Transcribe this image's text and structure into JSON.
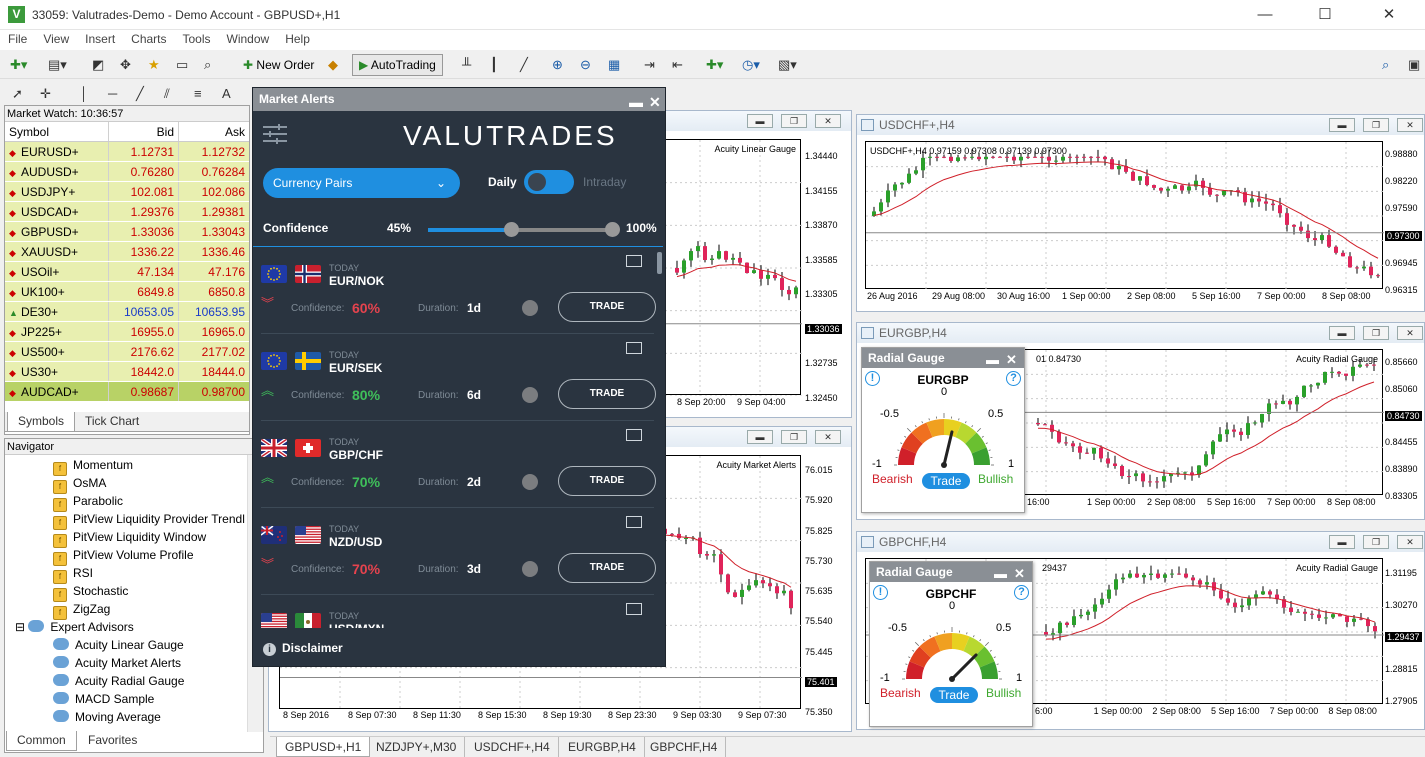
{
  "window": {
    "title": "33059: Valutrades-Demo - Demo Account - GBPUSD+,H1",
    "icon_letter": "V",
    "minimize": "—",
    "maximize": "☐",
    "close": "✕"
  },
  "menu": [
    "File",
    "View",
    "Insert",
    "Charts",
    "Tools",
    "Window",
    "Help"
  ],
  "toolbar": {
    "new_order_label": "New Order",
    "autotrading_label": "AutoTrading"
  },
  "market_watch": {
    "title": "Market Watch: 10:36:57",
    "columns": [
      "Symbol",
      "Bid",
      "Ask"
    ],
    "rows": [
      {
        "symbol": "EURUSD+",
        "bid": "1.12731",
        "ask": "1.12732",
        "dir": "down",
        "color": "red"
      },
      {
        "symbol": "AUDUSD+",
        "bid": "0.76280",
        "ask": "0.76284",
        "dir": "down",
        "color": "red"
      },
      {
        "symbol": "USDJPY+",
        "bid": "102.081",
        "ask": "102.086",
        "dir": "down",
        "color": "red"
      },
      {
        "symbol": "USDCAD+",
        "bid": "1.29376",
        "ask": "1.29381",
        "dir": "down",
        "color": "red"
      },
      {
        "symbol": "GBPUSD+",
        "bid": "1.33036",
        "ask": "1.33043",
        "dir": "down",
        "color": "red"
      },
      {
        "symbol": "XAUUSD+",
        "bid": "1336.22",
        "ask": "1336.46",
        "dir": "down",
        "color": "red"
      },
      {
        "symbol": "USOil+",
        "bid": "47.134",
        "ask": "47.176",
        "dir": "down",
        "color": "red"
      },
      {
        "symbol": "UK100+",
        "bid": "6849.8",
        "ask": "6850.8",
        "dir": "down",
        "color": "red"
      },
      {
        "symbol": "DE30+",
        "bid": "10653.05",
        "ask": "10653.95",
        "dir": "up",
        "color": "blue"
      },
      {
        "symbol": "JP225+",
        "bid": "16955.0",
        "ask": "16965.0",
        "dir": "down",
        "color": "red"
      },
      {
        "symbol": "US500+",
        "bid": "2176.62",
        "ask": "2177.02",
        "dir": "down",
        "color": "red"
      },
      {
        "symbol": "US30+",
        "bid": "18442.0",
        "ask": "18444.0",
        "dir": "down",
        "color": "red"
      },
      {
        "symbol": "AUDCAD+",
        "bid": "0.98687",
        "ask": "0.98700",
        "dir": "down",
        "color": "red"
      }
    ],
    "tabs": [
      "Symbols",
      "Tick Chart"
    ]
  },
  "navigator": {
    "title": "Navigator",
    "indicators": [
      "Momentum",
      "OsMA",
      "Parabolic",
      "PitView Liquidity Provider Trendl",
      "PitView Liquidity Window",
      "PitView Volume Profile",
      "RSI",
      "Stochastic",
      "ZigZag"
    ],
    "ea_group": "Expert Advisors",
    "experts": [
      "Acuity Linear Gauge",
      "Acuity Market Alerts",
      "Acuity Radial Gauge",
      "MACD Sample",
      "Moving Average"
    ],
    "tabs": [
      "Common",
      "Favorites"
    ]
  },
  "charts": {
    "gbpusd": {
      "label": "Acuity Linear Gauge",
      "prices": [
        "1.34440",
        "1.34155",
        "1.33870",
        "1.33585",
        "1.33305",
        "1.33036",
        "1.32735",
        "1.32450"
      ],
      "current": "1.33036",
      "xlabels": [
        "8 Sep 20:00",
        "9 Sep 04:00"
      ]
    },
    "nzdjpy": {
      "label": "Acuity Market Alerts",
      "prices": [
        "76.015",
        "75.920",
        "75.825",
        "75.730",
        "75.635",
        "75.540",
        "75.445",
        "75.401",
        "75.350"
      ],
      "current": "75.401",
      "xlabels": [
        "8 Sep 2016",
        "8 Sep 07:30",
        "8 Sep 11:30",
        "8 Sep 15:30",
        "8 Sep 19:30",
        "8 Sep 23:30",
        "9 Sep 03:30",
        "9 Sep 07:30"
      ]
    },
    "usdchf": {
      "title": "USDCHF+,H4",
      "info": "USDCHF+,H4  0.97159 0.97308 0.97139 0.97300",
      "prices": [
        "0.98880",
        "0.98220",
        "0.97590",
        "0.97300",
        "0.96945",
        "0.96315"
      ],
      "current": "0.97300",
      "xlabels": [
        "26 Aug 2016",
        "29 Aug 08:00",
        "30 Aug 16:00",
        "1 Sep 00:00",
        "2 Sep 08:00",
        "5 Sep 16:00",
        "7 Sep 00:00",
        "8 Sep 08:00"
      ]
    },
    "eurgbp": {
      "title": "EURGBP,H4",
      "info": "01 0.84730",
      "label": "Acuity Radial Gauge",
      "prices": [
        "0.85660",
        "0.85060",
        "0.84730",
        "0.84455",
        "0.83890",
        "0.83305"
      ],
      "current": "0.84730",
      "xlabels": [
        "16:00",
        "1 Sep 00:00",
        "2 Sep 08:00",
        "5 Sep 16:00",
        "7 Sep 00:00",
        "8 Sep 08:00"
      ]
    },
    "gbpchf": {
      "title": "GBPCHF,H4",
      "info": "29437",
      "label": "Acuity Radial Gauge",
      "prices": [
        "1.31195",
        "1.30270",
        "1.29437",
        "1.28815",
        "1.27905"
      ],
      "current": "1.29437",
      "xlabels": [
        "6:00",
        "1 Sep 00:00",
        "2 Sep 08:00",
        "5 Sep 16:00",
        "7 Sep 00:00",
        "8 Sep 08:00"
      ]
    }
  },
  "market_alerts": {
    "title": "Market Alerts",
    "logo": "VALUTRADES",
    "filter": "Currency Pairs",
    "period_left": "Daily",
    "period_right": "Intraday",
    "confidence_label": "Confidence",
    "confidence_min": "45%",
    "confidence_max": "100%",
    "confidence_min_frac": 0.45,
    "today": "TODAY",
    "conf_text": "Confidence:",
    "dur_text": "Duration:",
    "trade": "TRADE",
    "disclaimer": "Disclaimer",
    "alerts": [
      {
        "pair": "EUR/NOK",
        "confidence": "60%",
        "duration": "1d",
        "dir": "down"
      },
      {
        "pair": "EUR/SEK",
        "confidence": "80%",
        "duration": "6d",
        "dir": "up"
      },
      {
        "pair": "GBP/CHF",
        "confidence": "70%",
        "duration": "2d",
        "dir": "up"
      },
      {
        "pair": "NZD/USD",
        "confidence": "70%",
        "duration": "3d",
        "dir": "down"
      },
      {
        "pair": "USD/MXN",
        "confidence": "",
        "duration": "",
        "dir": ""
      }
    ]
  },
  "radial_gauges": [
    {
      "title": "Radial Gauge",
      "symbol": "EURGBP",
      "value": 0.15
    },
    {
      "title": "Radial Gauge",
      "symbol": "GBPCHF",
      "value": 0.5
    }
  ],
  "gauge_labels": {
    "zero": "0",
    "neg_half": "-0.5",
    "pos_half": "0.5",
    "neg_one": "-1",
    "pos_one": "1",
    "bearish": "Bearish",
    "trade": "Trade",
    "bullish": "Bullish"
  },
  "mdi_tabs": [
    "GBPUSD+,H1",
    "NZDJPY+,M30",
    "USDCHF+,H4",
    "EURGBP,H4",
    "GBPCHF,H4"
  ]
}
